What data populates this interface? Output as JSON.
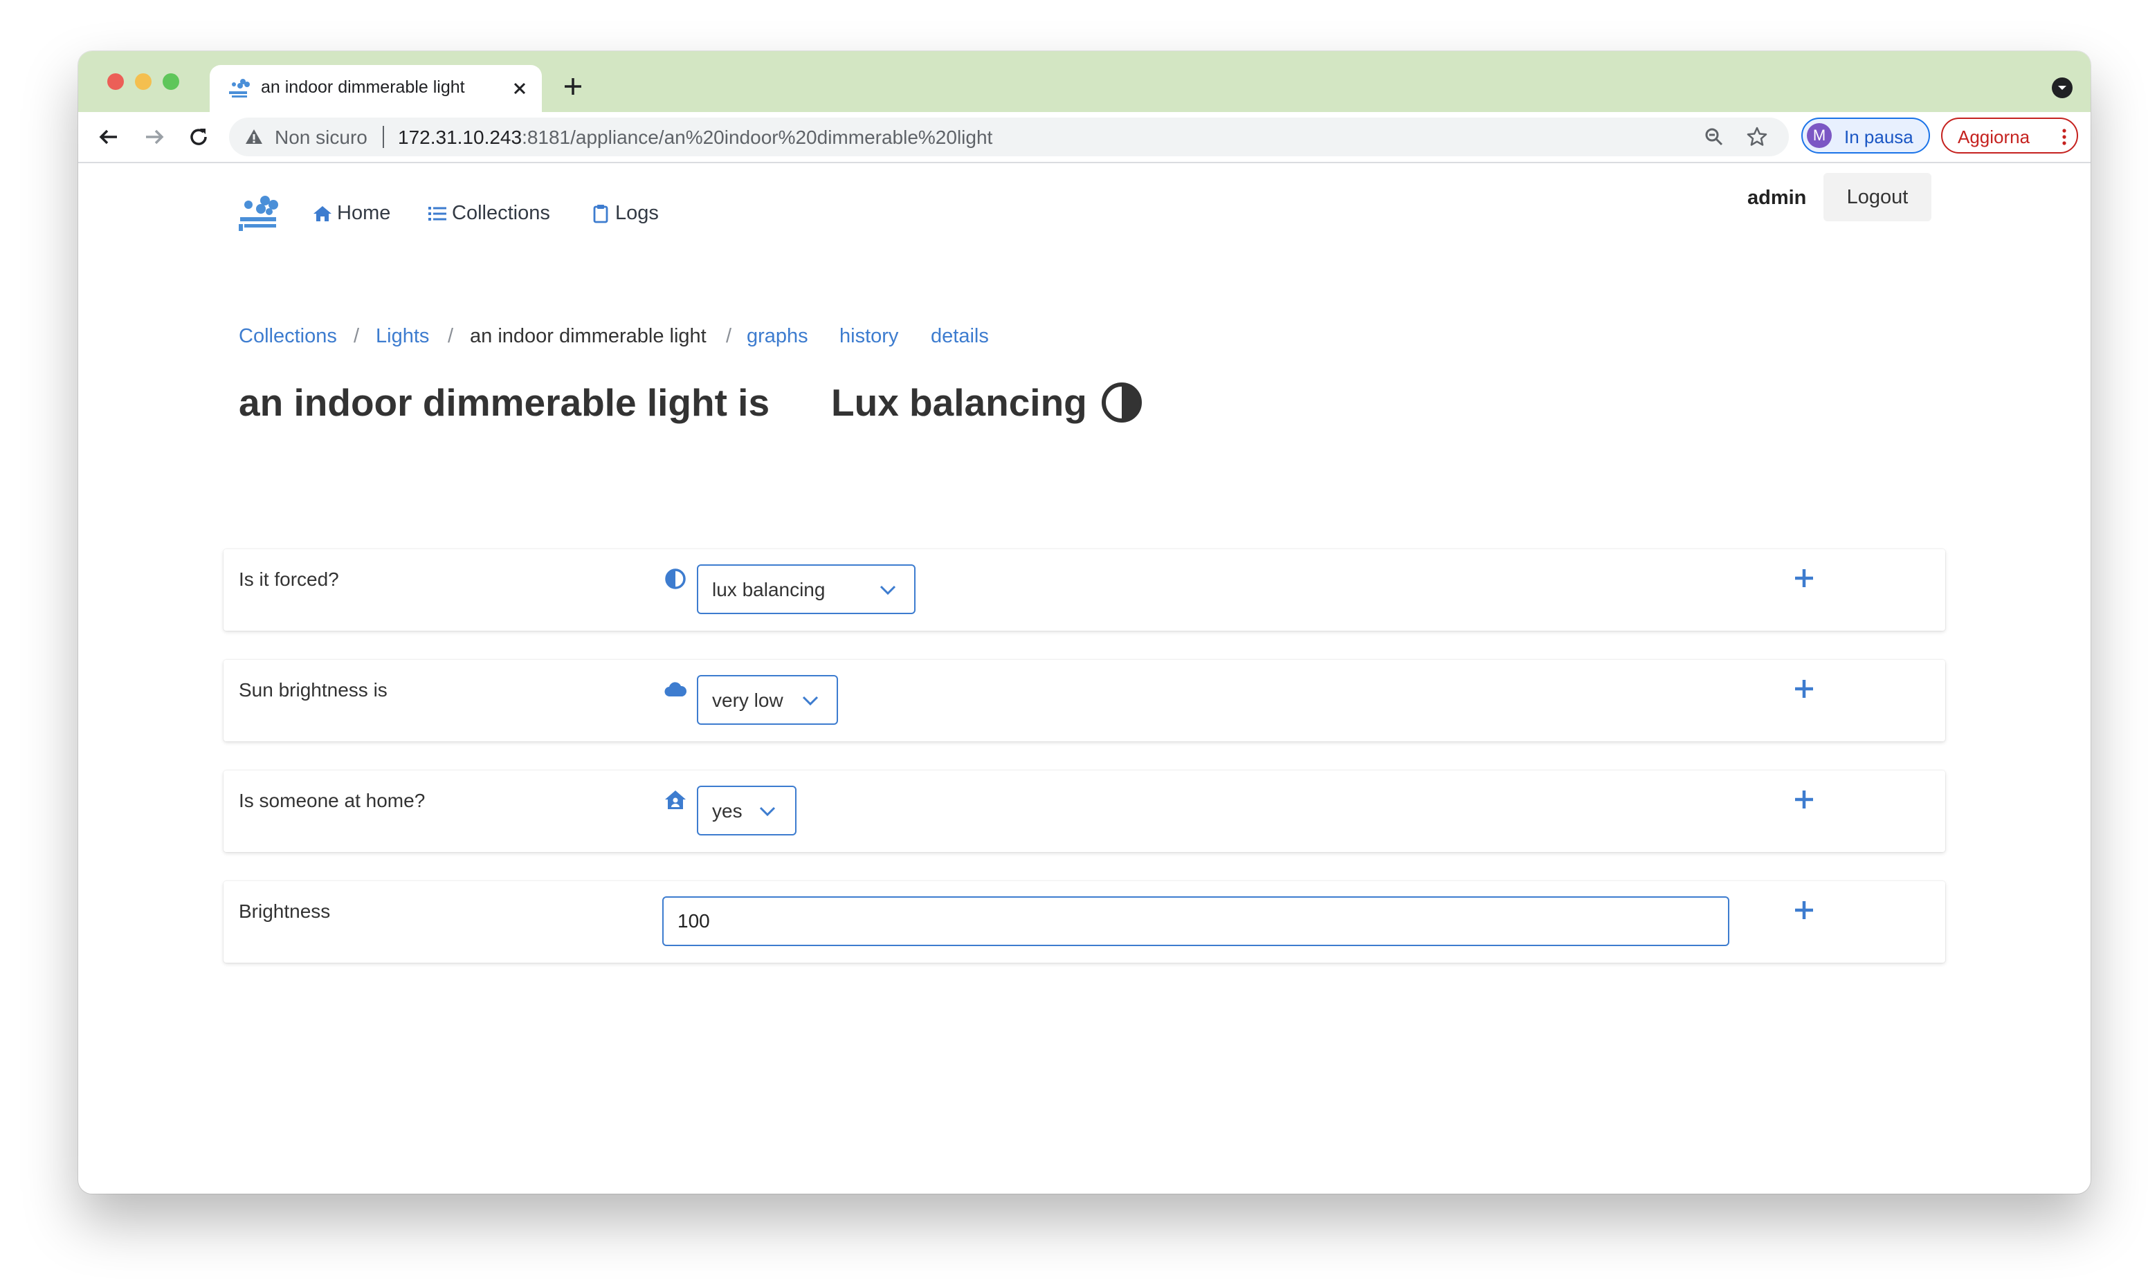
{
  "browser": {
    "tab_title": "an indoor dimmerable light",
    "security_label": "Non sicuro",
    "url_host": "172.31.10.243",
    "url_rest": ":8181/appliance/an%20indoor%20dimmerable%20light",
    "profile_initial": "M",
    "profile_status": "In pausa",
    "update_label": "Aggiorna"
  },
  "nav": {
    "home": "Home",
    "collections": "Collections",
    "logs": "Logs",
    "user": "admin",
    "logout": "Logout"
  },
  "breadcrumb": {
    "collections": "Collections",
    "lights": "Lights",
    "current": "an indoor dimmerable light",
    "graphs": "graphs",
    "history": "history",
    "details": "details"
  },
  "page": {
    "title": "an indoor dimmerable light is",
    "state": "Lux balancing"
  },
  "fields": {
    "forced": {
      "label": "Is it forced?",
      "value": "lux balancing"
    },
    "sun": {
      "label": "Sun brightness is",
      "value": "very low"
    },
    "home": {
      "label": "Is someone at home?",
      "value": "yes"
    },
    "brightness": {
      "label": "Brightness",
      "value": "100"
    }
  },
  "colors": {
    "accent": "#3d7ccf",
    "tabstrip": "#d3e6c3"
  }
}
